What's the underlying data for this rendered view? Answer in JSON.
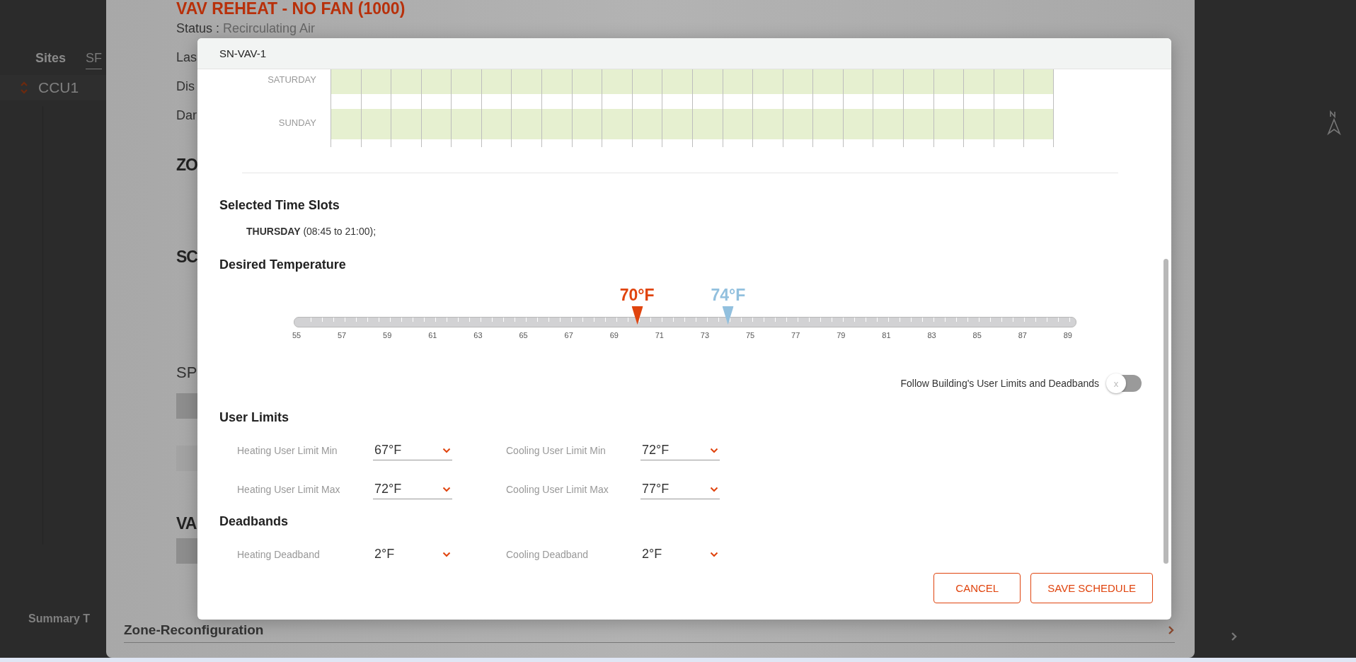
{
  "background_page": {
    "tabs": [
      {
        "label": "Sites",
        "selected": true
      },
      {
        "label": "SF",
        "selected": false
      }
    ],
    "site": "CCU1",
    "section": "Summary T"
  },
  "zone_panel": {
    "title": "VAV REHEAT - NO FAN (1000)",
    "status_label": "Status :",
    "status_value": "Recirculating Air",
    "fields": [
      "Las",
      "Dis",
      "Dar"
    ],
    "headings": [
      "ZO",
      "SC"
    ],
    "sp_heading": "SP",
    "va_heading": "VA",
    "footer": "Zone-Reconfiguration"
  },
  "modal": {
    "title": "SN-VAV-1",
    "schedule_days": [
      {
        "label": "SATURDAY"
      },
      {
        "label": "SUNDAY"
      }
    ],
    "selected_slots": {
      "heading": "Selected Time Slots",
      "day": "THURSDAY",
      "range": "(08:45 to 21:00);"
    },
    "desired_temperature": {
      "heading": "Desired Temperature",
      "scale": [
        "55",
        "57",
        "59",
        "61",
        "63",
        "65",
        "67",
        "69",
        "71",
        "73",
        "75",
        "77",
        "79",
        "81",
        "83",
        "85",
        "87",
        "89"
      ],
      "heating": {
        "label": "70°F",
        "level": 0.441
      },
      "cooling": {
        "label": "74°F",
        "level": 0.559
      }
    },
    "follow_building": {
      "label": "Follow Building's User Limits and Deadbands",
      "on": false,
      "knob_glyph": "x"
    },
    "sections": [
      {
        "title": "User Limits",
        "rows": [
          [
            {
              "label": "Heating User Limit Min",
              "value": "67°F"
            },
            {
              "label": "Cooling User Limit Min",
              "value": "72°F"
            }
          ],
          [
            {
              "label": "Heating User Limit Max",
              "value": "72°F"
            },
            {
              "label": "Cooling User Limit Max",
              "value": "77°F"
            }
          ]
        ]
      },
      {
        "title": "Deadbands",
        "rows": [
          [
            {
              "label": "Heating Deadband",
              "value": "2°F"
            },
            {
              "label": "Cooling Deadband",
              "value": "2°F"
            }
          ]
        ]
      }
    ],
    "buttons": [
      "CANCEL",
      "SAVE SCHEDULE"
    ]
  }
}
